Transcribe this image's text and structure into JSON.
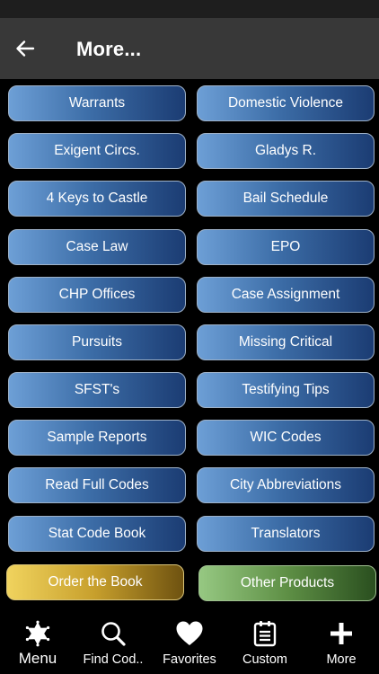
{
  "header": {
    "title": "More..."
  },
  "buttons": [
    "Warrants",
    "Domestic Violence",
    "Exigent Circs.",
    "Gladys R.",
    "4 Keys to Castle",
    "Bail Schedule",
    "Case Law",
    "EPO",
    "CHP Offices",
    "Case Assignment",
    "Pursuits",
    "Missing Critical",
    "SFST's",
    "Testifying Tips",
    "Sample Reports",
    "WIC Codes",
    "Read Full Codes",
    "City Abbreviations",
    "Stat Code Book",
    "Translators"
  ],
  "promo": {
    "order_label": "Order the Book",
    "other_label": "Other Products"
  },
  "nav": {
    "menu": "Menu",
    "find": "Find Cod..",
    "favorites": "Favorites",
    "custom": "Custom",
    "more": "More"
  },
  "colors": {
    "app_bar": "#383838",
    "button_light": "#6d9fd6",
    "button_dark": "#1b3c73",
    "gold": "#f0d35e",
    "green": "#96c882"
  }
}
